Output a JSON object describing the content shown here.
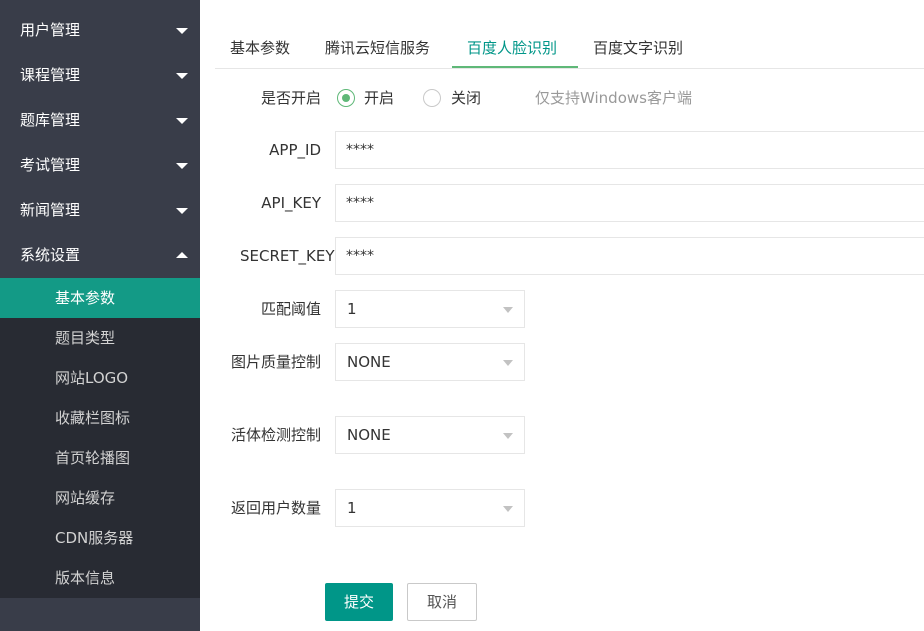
{
  "sidebar": {
    "items": [
      {
        "label": "用户管理",
        "expanded": false
      },
      {
        "label": "课程管理",
        "expanded": false
      },
      {
        "label": "题库管理",
        "expanded": false
      },
      {
        "label": "考试管理",
        "expanded": false
      },
      {
        "label": "新闻管理",
        "expanded": false
      },
      {
        "label": "系统设置",
        "expanded": true
      }
    ],
    "submenu": [
      {
        "label": "基本参数",
        "active": true
      },
      {
        "label": "题目类型"
      },
      {
        "label": "网站LOGO"
      },
      {
        "label": "收藏栏图标"
      },
      {
        "label": "首页轮播图"
      },
      {
        "label": "网站缓存"
      },
      {
        "label": "CDN服务器"
      },
      {
        "label": "版本信息"
      }
    ]
  },
  "tabs": [
    {
      "label": "基本参数"
    },
    {
      "label": "腾讯云短信服务"
    },
    {
      "label": "百度人脸识别",
      "active": true
    },
    {
      "label": "百度文字识别"
    }
  ],
  "form": {
    "enable": {
      "label": "是否开启",
      "options": [
        {
          "label": "开启",
          "checked": true
        },
        {
          "label": "关闭",
          "checked": false
        }
      ],
      "hint": "仅支持Windows客户端"
    },
    "app_id": {
      "label": "APP_ID",
      "value": "****"
    },
    "api_key": {
      "label": "API_KEY",
      "value": "****"
    },
    "secret_key": {
      "label": "SECRET_KEY",
      "value": "****"
    },
    "match_threshold": {
      "label": "匹配阈值",
      "value": "1"
    },
    "quality_control": {
      "label": "图片质量控制",
      "value": "NONE"
    },
    "liveness_control": {
      "label": "活体检测控制",
      "value": "NONE"
    },
    "user_count": {
      "label": "返回用户数量",
      "value": "1"
    }
  },
  "buttons": {
    "submit": "提交",
    "cancel": "取消"
  },
  "colors": {
    "sidebar_bg": "#393d49",
    "submenu_bg": "#282b33",
    "accent": "#009688",
    "radio_checked": "#5fb878"
  }
}
